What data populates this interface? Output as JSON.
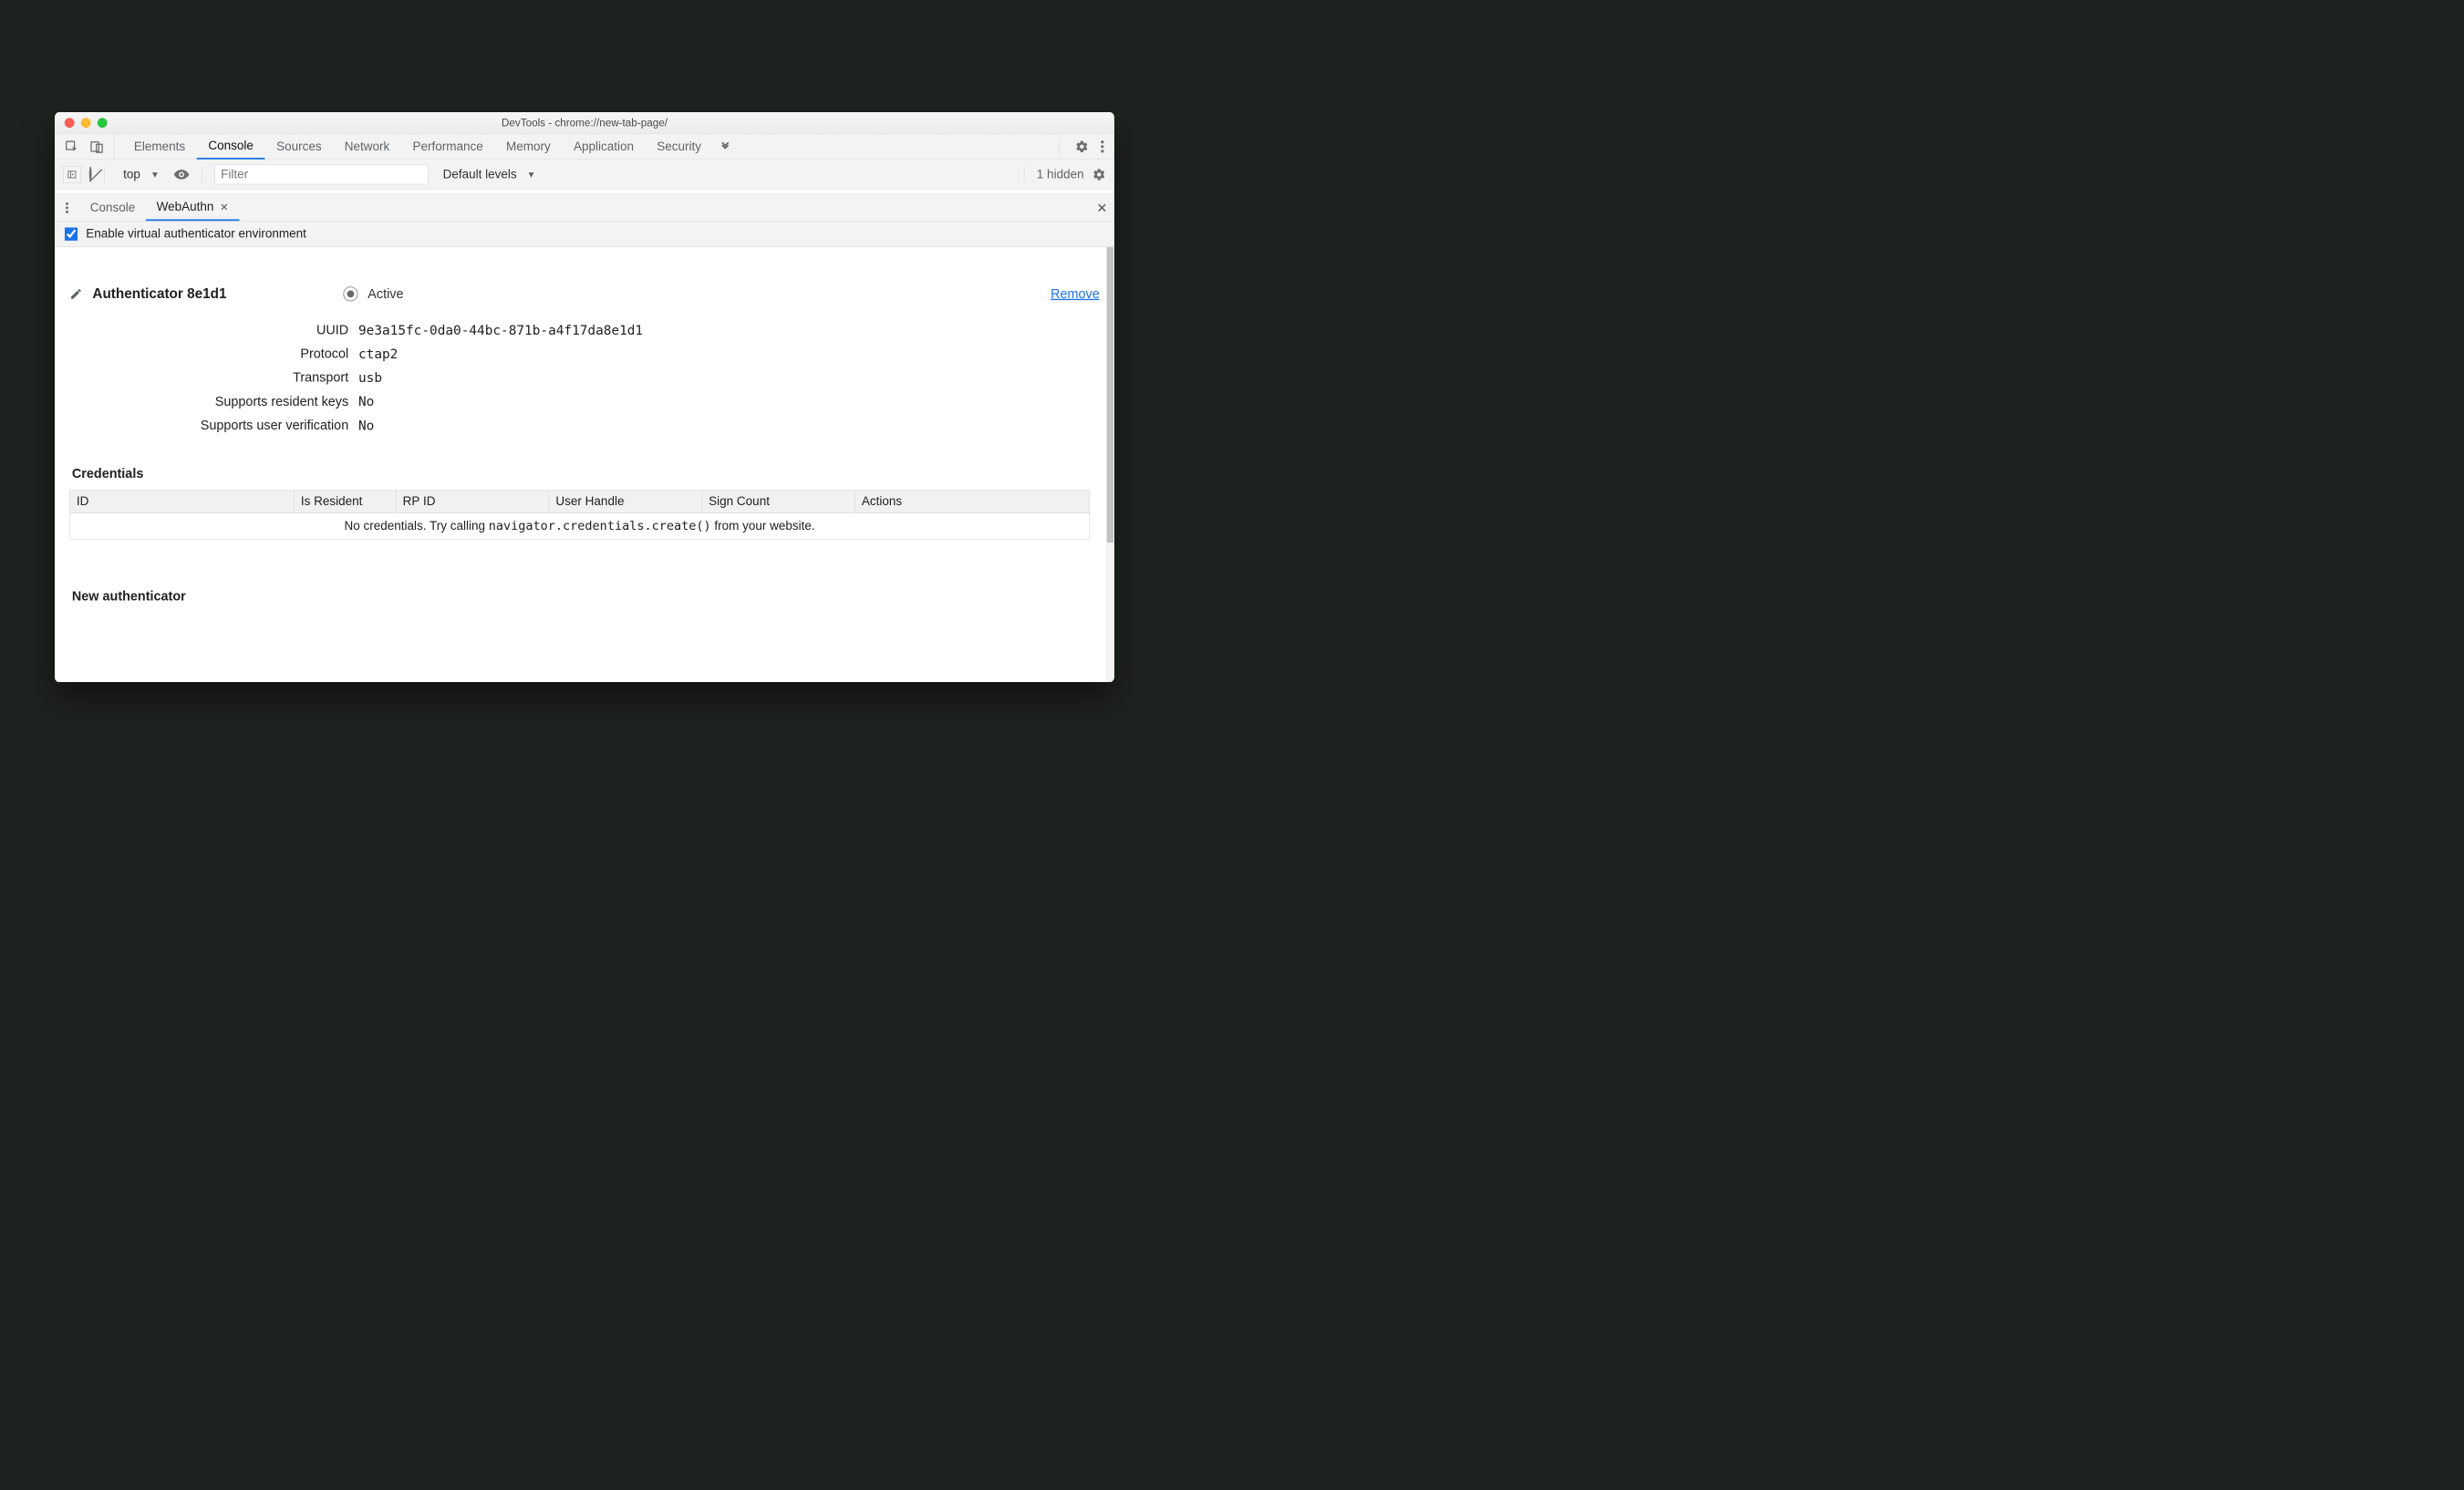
{
  "window": {
    "title": "DevTools - chrome://new-tab-page/"
  },
  "main_tabs": {
    "items": [
      "Elements",
      "Console",
      "Sources",
      "Network",
      "Performance",
      "Memory",
      "Application",
      "Security"
    ],
    "active": "Console"
  },
  "console_toolbar": {
    "context": "top",
    "filter_placeholder": "Filter",
    "levels": "Default levels",
    "hidden": "1 hidden"
  },
  "drawer": {
    "tabs": [
      "Console",
      "WebAuthn"
    ],
    "active": "WebAuthn"
  },
  "enable": {
    "label": "Enable virtual authenticator environment",
    "checked": true
  },
  "authenticator": {
    "name": "Authenticator 8e1d1",
    "active_label": "Active",
    "remove_label": "Remove",
    "fields": {
      "uuid_label": "UUID",
      "uuid": "9e3a15fc-0da0-44bc-871b-a4f17da8e1d1",
      "protocol_label": "Protocol",
      "protocol": "ctap2",
      "transport_label": "Transport",
      "transport": "usb",
      "rk_label": "Supports resident keys",
      "rk": "No",
      "uv_label": "Supports user verification",
      "uv": "No"
    }
  },
  "credentials": {
    "heading": "Credentials",
    "columns": [
      "ID",
      "Is Resident",
      "RP ID",
      "User Handle",
      "Sign Count",
      "Actions"
    ],
    "empty_pre": "No credentials. Try calling ",
    "empty_code": "navigator.credentials.create()",
    "empty_post": " from your website."
  },
  "new_auth": {
    "heading": "New authenticator"
  }
}
